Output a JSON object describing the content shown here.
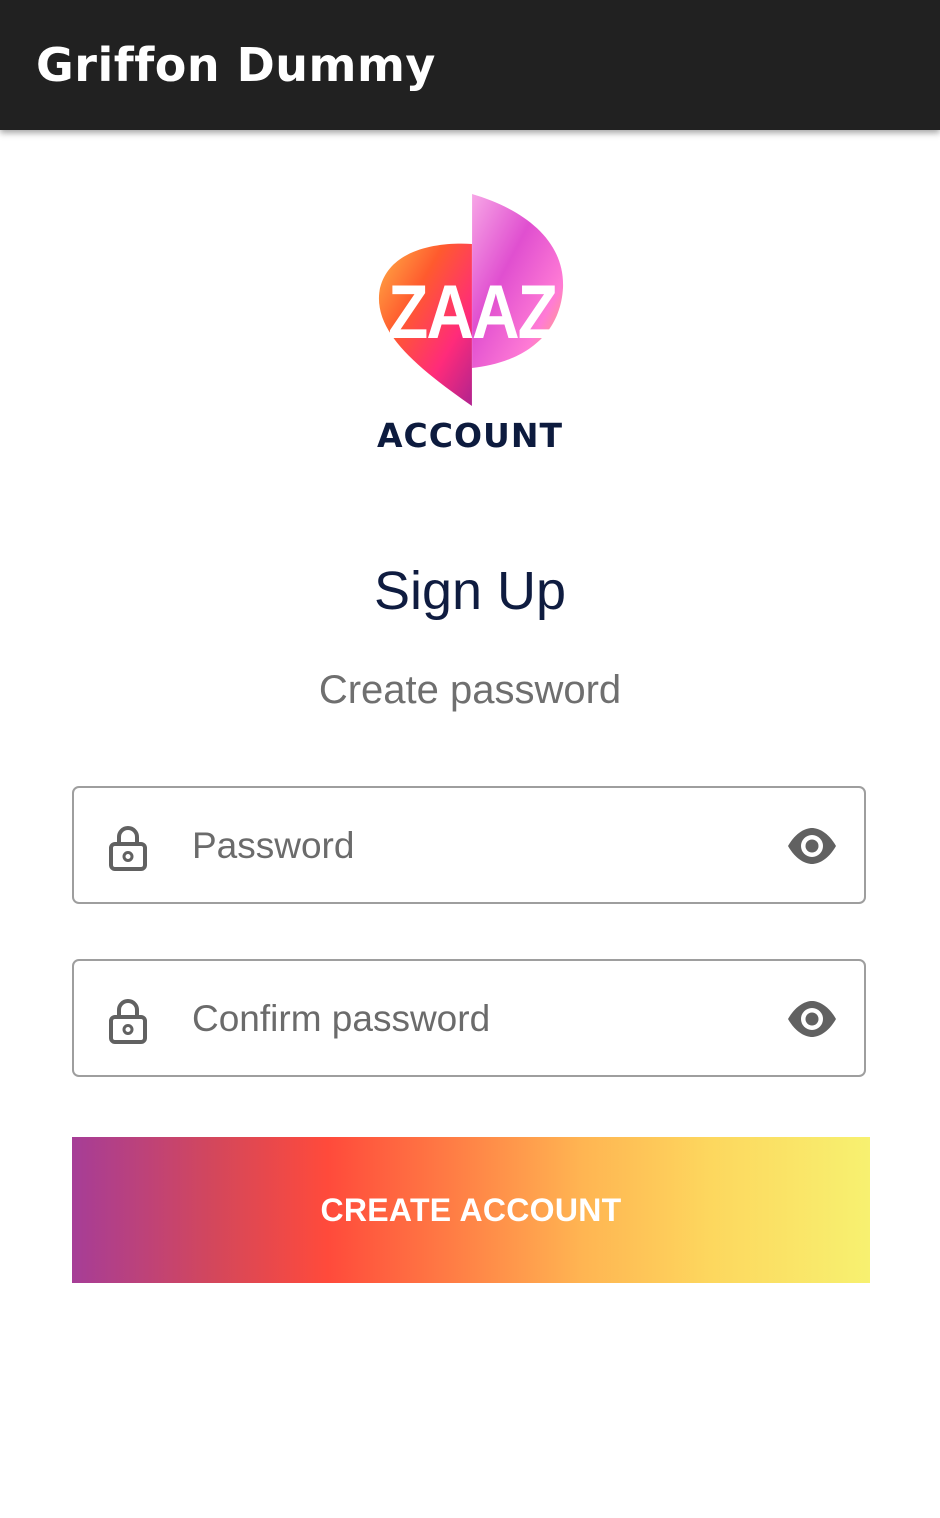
{
  "app_bar": {
    "title": "Griffon Dummy"
  },
  "logo": {
    "wordmark": "ZAAZ",
    "caption": "ACCOUNT",
    "colors": [
      "#ff5a2e",
      "#ff2b7a",
      "#d13fb0",
      "#ffb347"
    ]
  },
  "heading": {
    "title": "Sign Up",
    "subtitle": "Create password"
  },
  "form": {
    "password": {
      "placeholder": "Password",
      "value": "",
      "leading_icon": "lock-icon",
      "trailing_icon": "eye-icon"
    },
    "confirm_password": {
      "placeholder": "Confirm password",
      "value": "",
      "leading_icon": "lock-icon",
      "trailing_icon": "eye-icon"
    },
    "submit_label": "CREATE ACCOUNT"
  },
  "colors": {
    "app_bar": "#212121",
    "title_text": "#0f1c40",
    "subtitle_text": "#6f6f6f",
    "button_gradient": [
      "#a63d97",
      "#ff4a3b",
      "#ffb552",
      "#f7f170"
    ]
  }
}
